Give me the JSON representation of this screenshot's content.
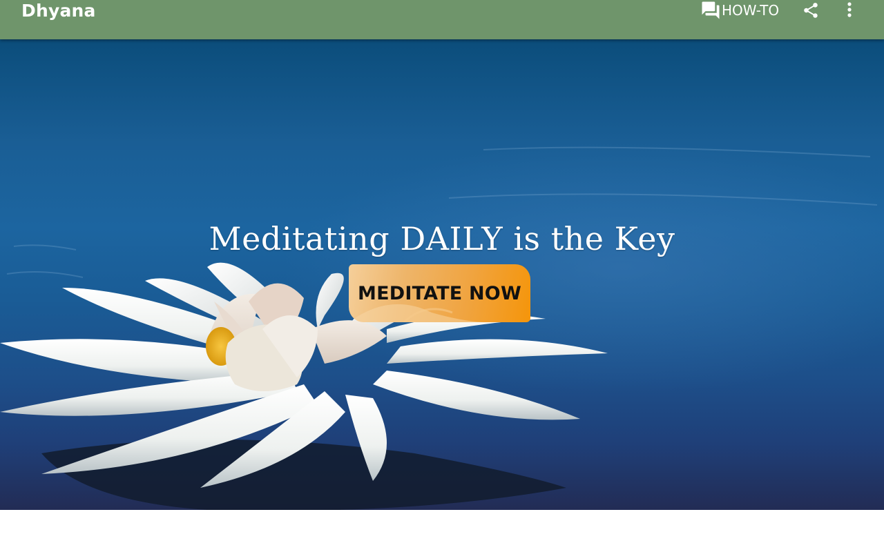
{
  "appbar": {
    "title": "Dhyana",
    "howto_label": "HOW-TO",
    "icons": [
      "forum-icon",
      "share-icon",
      "more-vert-icon"
    ],
    "color": "#6f956b"
  },
  "hero": {
    "tagline": "Meditating DAILY is the Key",
    "button_label": "MEDITATE NOW",
    "image": "white-lotus-on-blue-water"
  }
}
